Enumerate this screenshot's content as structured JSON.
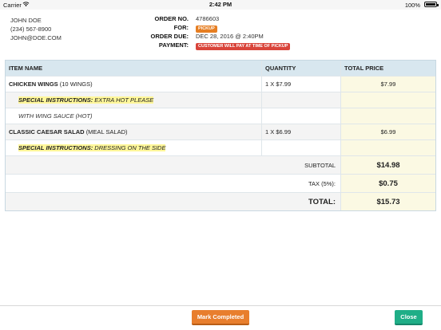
{
  "status_bar": {
    "carrier": "Carrier",
    "time": "2:42 PM",
    "battery": "100%"
  },
  "customer": {
    "name": "JOHN DOE",
    "phone": "(234) 567-8900",
    "email": "JOHN@DOE.COM"
  },
  "order": {
    "number_label": "ORDER NO.",
    "number": "4786603",
    "for_label": "FOR:",
    "for_value": "PICKUP",
    "due_label": "ORDER DUE:",
    "due_value": "DEC 28, 2016 @ 2:40PM",
    "payment_label": "PAYMENT:",
    "payment_value": "CUSTOMER WILL PAY AT TIME OF PICKUP"
  },
  "colors": {
    "pickup_badge": "#e67e22",
    "payment_badge": "#d9443a",
    "header_bg": "#d8e7ef",
    "price_bg": "#fbf9e3",
    "highlight": "#fff79a",
    "complete_btn": "#e87e2d",
    "close_btn": "#1fae87"
  },
  "table": {
    "headers": {
      "item": "ITEM NAME",
      "quantity": "QUANTITY",
      "price": "TOTAL PRICE"
    },
    "items": [
      {
        "name": "CHICKEN WINGS",
        "detail": "(10 WINGS)",
        "qty": "1 X $7.99",
        "price": "$7.99",
        "instr_label": "SPECIAL INSTRUCTIONS:",
        "instr_text": "EXTRA HOT PLEASE",
        "option": "WITH WING SAUCE (HOT)"
      },
      {
        "name": "CLASSIC CAESAR SALAD",
        "detail": "(MEAL SALAD)",
        "qty": "1 X $6.99",
        "price": "$6.99",
        "instr_label": "SPECIAL INSTRUCTIONS:",
        "instr_text": "DRESSING ON THE SIDE"
      }
    ],
    "subtotal_label": "SUBTOTAL",
    "subtotal": "$14.98",
    "tax_label": "TAX (5%):",
    "tax": "$0.75",
    "total_label": "TOTAL:",
    "total": "$15.73"
  },
  "actions": {
    "complete_label": "Mark Completed",
    "close_label": "Close"
  }
}
